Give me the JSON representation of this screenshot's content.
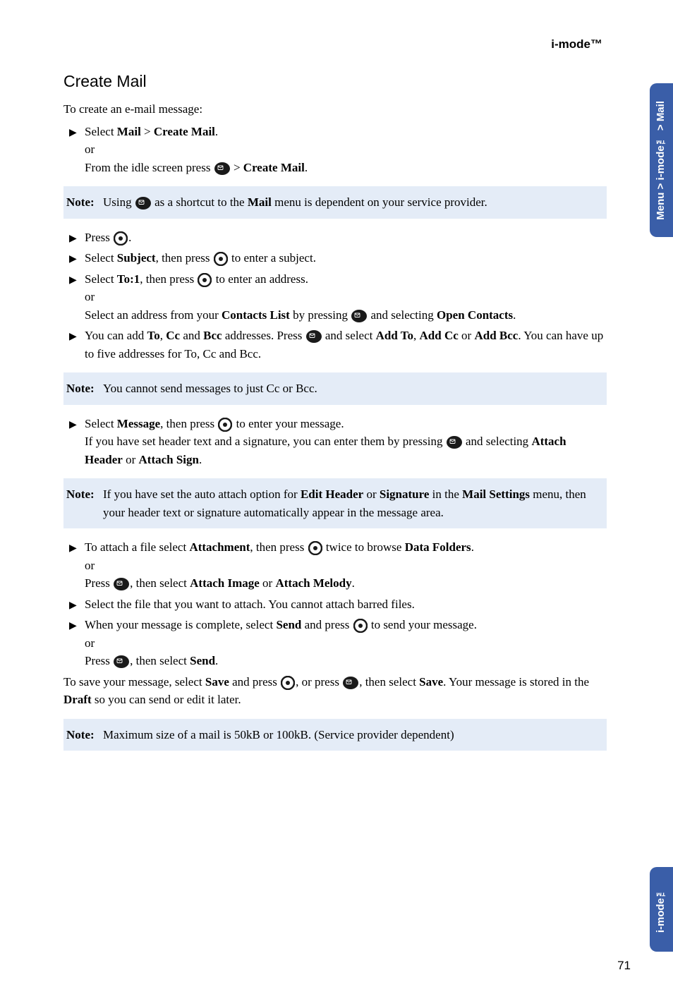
{
  "header": "i-mode™",
  "section_title": "Create Mail",
  "intro": "To create an e-mail message:",
  "step1_a": "Select ",
  "step1_b": "Mail",
  "step1_c": " > ",
  "step1_d": "Create Mail",
  "step1_e": ".",
  "or": "or",
  "step1_f": "From the idle screen press ",
  "step1_g": " > ",
  "step1_h": "Create Mail",
  "step1_i": ".",
  "note1_label": "Note:",
  "note1_a": "Using ",
  "note1_b": " as a shortcut to the ",
  "note1_c": "Mail",
  "note1_d": " menu is dependent on your service provider.",
  "step2_a": "Press ",
  "step2_b": ".",
  "step3_a": "Select ",
  "step3_b": "Subject",
  "step3_c": ", then press ",
  "step3_d": " to enter a subject.",
  "step4_a": "Select ",
  "step4_b": "To:1",
  "step4_c": ", then press ",
  "step4_d": " to enter an address.",
  "step4_e": "Select an address from your ",
  "step4_f": "Contacts List",
  "step4_g": " by pressing ",
  "step4_h": " and selecting ",
  "step4_i": "Open Contacts",
  "step4_j": ".",
  "step5_a": "You can add ",
  "step5_b": "To",
  "step5_c": ", ",
  "step5_d": "Cc",
  "step5_e": " and ",
  "step5_f": "Bcc",
  "step5_g": " addresses. Press ",
  "step5_h": " and select ",
  "step5_i": "Add To",
  "step5_j": ", ",
  "step5_k": "Add Cc",
  "step5_l": " or ",
  "step5_m": "Add Bcc",
  "step5_n": ". You can have up to five addresses for To, Cc and Bcc.",
  "note2_label": "Note:",
  "note2_text": "You cannot send messages to just Cc or Bcc.",
  "step6_a": "Select ",
  "step6_b": "Message",
  "step6_c": ", then press ",
  "step6_d": " to enter your message.",
  "step6_e": "If you have set header text and a signature, you can enter them by pressing ",
  "step6_f": " and selecting ",
  "step6_g": "Attach Header",
  "step6_h": " or ",
  "step6_i": "Attach Sign",
  "step6_j": ".",
  "note3_label": "Note:",
  "note3_a": "If you have set the auto attach option for ",
  "note3_b": "Edit Header",
  "note3_c": " or ",
  "note3_d": "Signature",
  "note3_e": " in the ",
  "note3_f": "Mail Settings",
  "note3_g": " menu, then your header text or signature automatically appear in the message area.",
  "step7_a": "To attach a file select ",
  "step7_b": "Attachment",
  "step7_c": ", then press ",
  "step7_d": " twice to browse ",
  "step7_e": "Data Folders",
  "step7_f": ".",
  "step7_g": "Press ",
  "step7_h": ", then select ",
  "step7_i": "Attach Image",
  "step7_j": " or ",
  "step7_k": "Attach Melody",
  "step7_l": ".",
  "step8": "Select the file that you want to attach. You cannot attach barred files.",
  "step9_a": "When your message is complete, select ",
  "step9_b": "Send",
  "step9_c": " and press ",
  "step9_d": " to send your message.",
  "step9_e": "Press ",
  "step9_f": ", then select ",
  "step9_g": "Send",
  "step9_h": ".",
  "save_a": "To save your message, select ",
  "save_b": "Save",
  "save_c": " and press ",
  "save_d": ", or press ",
  "save_e": ", then select ",
  "save_f": "Save",
  "save_g": ". Your message is stored in the ",
  "save_h": "Draft",
  "save_i": " so you can send or edit it later.",
  "note4_label": "Note:",
  "note4_text": "Maximum size of a mail is 50kB or 100kB. (Service provider dependent)",
  "side_top": "Menu > i-mode™ > Mail",
  "side_bottom": "i-mode™",
  "page_number": "71"
}
